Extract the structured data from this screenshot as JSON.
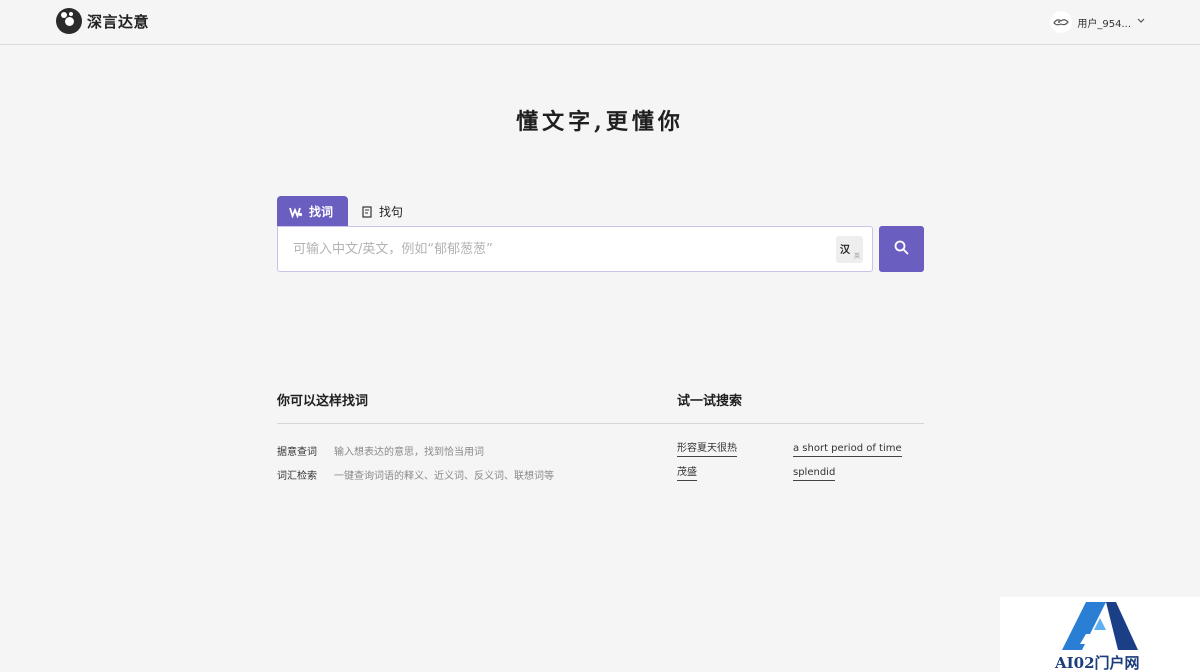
{
  "header": {
    "logo_text": "深言达意",
    "user_name": "用户_954...",
    "icons": {
      "logo": "panda-logo-icon",
      "avatar": "user-avatar-icon",
      "chevron": "chevron-down-icon"
    }
  },
  "hero": {
    "slogan": "懂文字,更懂你"
  },
  "tabs": [
    {
      "label": "找词",
      "icon": "find-word-icon",
      "active": true
    },
    {
      "label": "找句",
      "icon": "find-sentence-icon",
      "active": false
    }
  ],
  "search": {
    "placeholder": "可输入中文/英文，例如“郁郁葱葱”",
    "value": "",
    "lang_toggle_label": "汉",
    "lang_toggle_sub": "英",
    "button_icon": "search-icon"
  },
  "usage": {
    "title": "你可以这样找词",
    "rows": [
      {
        "label": "据意查词",
        "desc": "输入想表达的意思，找到恰当用词"
      },
      {
        "label": "词汇检索",
        "desc": "一键查询词语的释义、近义词、反义词、联想词等"
      }
    ]
  },
  "try_search": {
    "title": "试一试搜索",
    "links": [
      "形容夏天很热",
      "a short period of time",
      "茂盛",
      "splendid"
    ]
  },
  "watermark": {
    "text": "AI02门户网"
  },
  "colors": {
    "accent": "#6a5fc1",
    "background": "#f5f5f5",
    "input_border": "#c9c3eb"
  }
}
